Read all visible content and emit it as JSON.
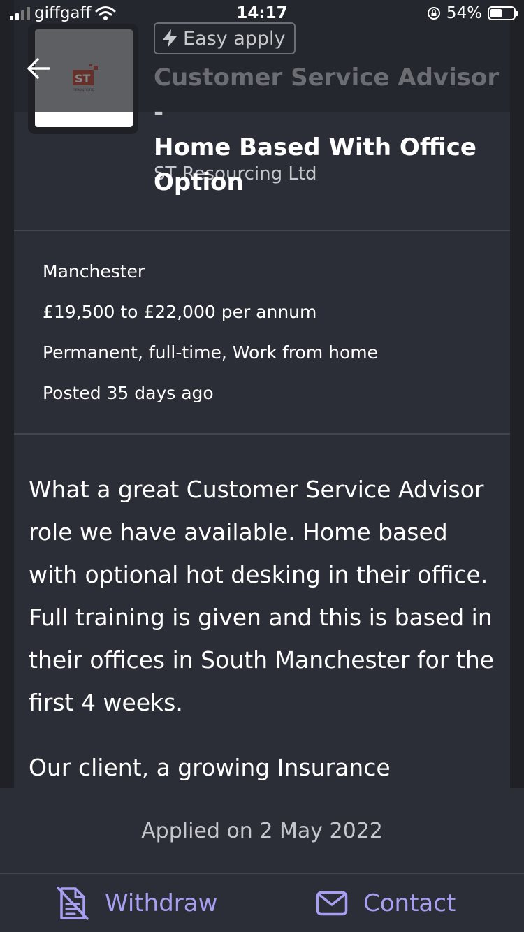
{
  "status_bar": {
    "carrier": "giffgaff",
    "time": "14:17",
    "battery": "54%"
  },
  "job": {
    "badge": "Easy apply",
    "title_lines": [
      "Customer Service Advisor -",
      "Home Based With Office",
      "Option"
    ],
    "company": "ST Resourcing Ltd",
    "logo_text": "ST",
    "logo_subtext": "resourcing"
  },
  "details": {
    "location": "Manchester",
    "salary": "£19,500 to £22,000 per annum",
    "type": "Permanent, full-time, Work from home",
    "posted": "Posted 35 days ago"
  },
  "description": {
    "paragraph1": "What a great Customer Service Advisor role we have available. Home based with optional hot desking in their office. Full training is given and this is based in their offices in South Manchester for the first 4 weeks.",
    "paragraph2": "Our client, a growing Insurance Brokerage"
  },
  "footer": {
    "applied": "Applied on 2 May 2022",
    "withdraw_label": "Withdraw",
    "contact_label": "Contact"
  },
  "colors": {
    "accent": "#a79ff2",
    "background": "#2b2e36",
    "logo_red": "#b5402a"
  },
  "icons": [
    "back-arrow-icon",
    "lightning-icon",
    "withdraw-document-icon",
    "mail-icon",
    "wifi-icon",
    "lock-rotation-icon"
  ]
}
